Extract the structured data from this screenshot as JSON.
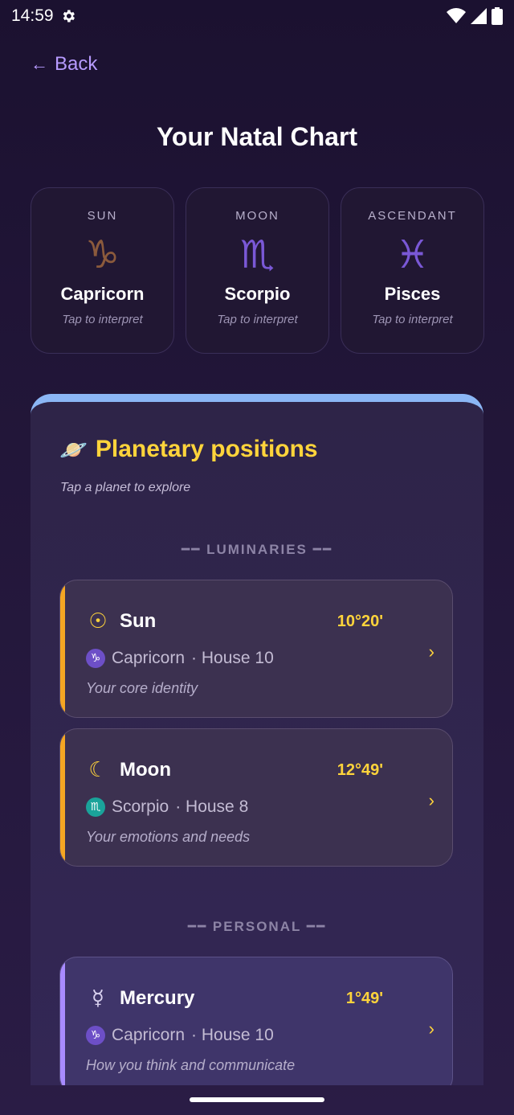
{
  "status_bar": {
    "time": "14:59"
  },
  "nav": {
    "back_label": "Back",
    "back_arrow": "←"
  },
  "page_title": "Your Natal Chart",
  "big_three": [
    {
      "label": "SUN",
      "glyph": "♑︎",
      "sign": "Capricorn",
      "hint": "Tap to interpret",
      "color": "#8b5a3c"
    },
    {
      "label": "MOON",
      "glyph": "♏︎",
      "sign": "Scorpio",
      "hint": "Tap to interpret",
      "color": "#7a58d6"
    },
    {
      "label": "ASCENDANT",
      "glyph": "♓︎",
      "sign": "Pisces",
      "hint": "Tap to interpret",
      "color": "#7a58d6"
    }
  ],
  "planets_panel": {
    "icon": "ringed-planet-icon",
    "icon_glyph": "🪐",
    "title": "Planetary positions",
    "subtitle": "Tap a planet to explore",
    "sections": {
      "luminaries": "━━ LUMINARIES ━━",
      "personal": "━━ PERSONAL ━━"
    },
    "planets": [
      {
        "name": "Sun",
        "glyph": "☉",
        "degree": "10°20'",
        "sign_glyph": "♑︎",
        "sign": "Capricorn",
        "house": " · House 10",
        "description": "Your core identity",
        "accent": "#f5a623",
        "badge_color": "#6d4fc7",
        "glyph_color": "#ffd43b"
      },
      {
        "name": "Moon",
        "glyph": "☾",
        "degree": "12°49'",
        "sign_glyph": "♏︎",
        "sign": "Scorpio",
        "house": " · House 8",
        "description": "Your emotions and needs",
        "accent": "#f5a623",
        "badge_color": "#1aa39a",
        "glyph_color": "#ffd43b"
      },
      {
        "name": "Mercury",
        "glyph": "☿",
        "degree": "1°49'",
        "sign_glyph": "♑︎",
        "sign": "Capricorn",
        "house": " · House 10",
        "description": "How you think and communicate",
        "accent": "#a88bff",
        "badge_color": "#6d4fc7",
        "glyph_color": "#d8d0ee"
      }
    ]
  }
}
